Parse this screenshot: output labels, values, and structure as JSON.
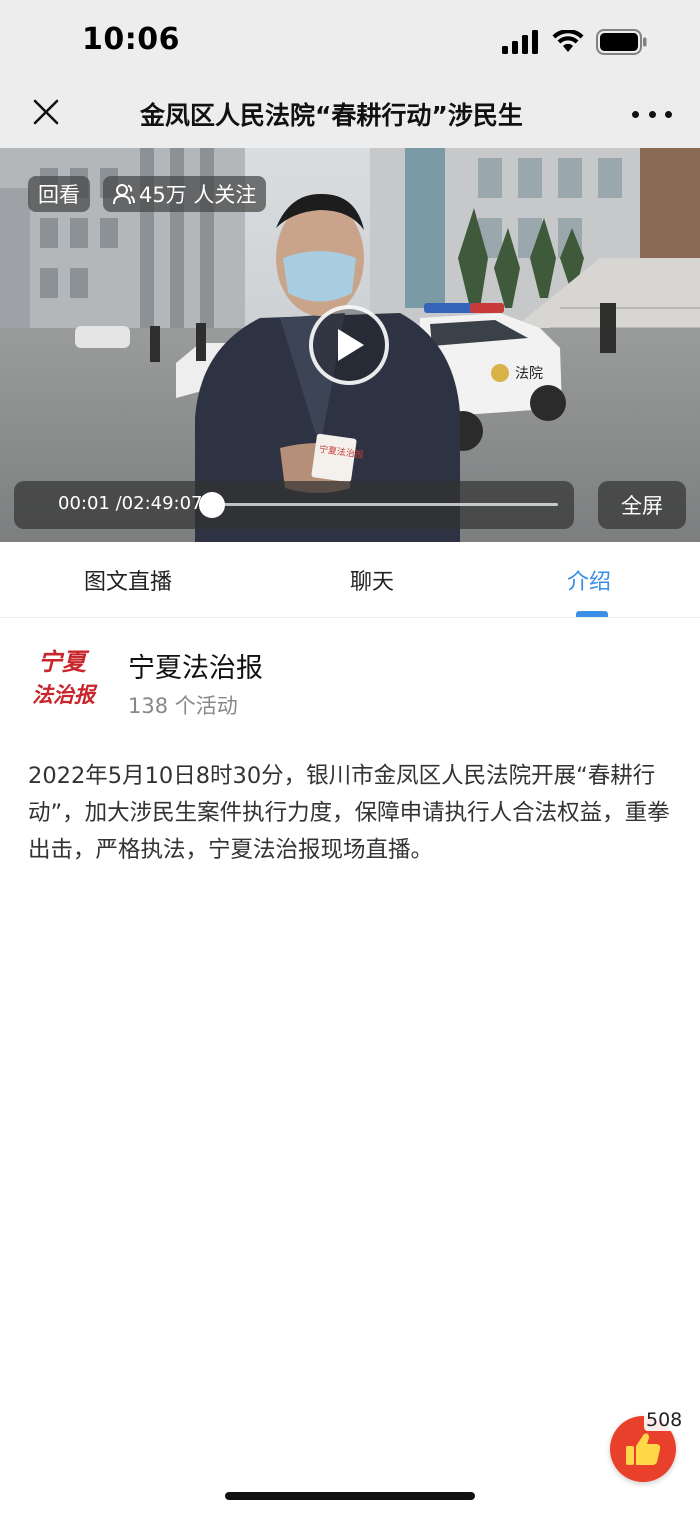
{
  "status_bar": {
    "time": "10:06"
  },
  "header": {
    "title": "金凤区人民法院“春耕行动”涉民生"
  },
  "video": {
    "replay_badge": "回看",
    "viewers_label": "45万 人关注",
    "progress_time": "00:01 /02:49:07",
    "progress_fraction": 0.0001,
    "fullscreen_label": "全屏",
    "scene_text": "法院",
    "card_text": "宁夏法治报"
  },
  "tabs": [
    {
      "label": "图文直播",
      "active": false
    },
    {
      "label": "聊天",
      "active": false
    },
    {
      "label": "介绍",
      "active": true
    }
  ],
  "publisher": {
    "name": "宁夏法治报",
    "activity_count": "138 个活动",
    "logo_text": "宁夏法治报"
  },
  "description": "2022年5月10日8时30分，银川市金凤区人民法院开展“春耕行动”，加大涉民生案件执行力度，保障申请执行人合法权益，重拳出击，严格执法，宁夏法治报现场直播。",
  "like": {
    "count": "508"
  },
  "colors": {
    "accent": "#3a8ee6",
    "like": "#e8402a",
    "header_bg": "#ededed"
  },
  "icons": {
    "close": "close-icon",
    "more": "more-icon",
    "play": "play-icon",
    "viewers": "person-icon",
    "like": "thumbs-up-icon"
  }
}
